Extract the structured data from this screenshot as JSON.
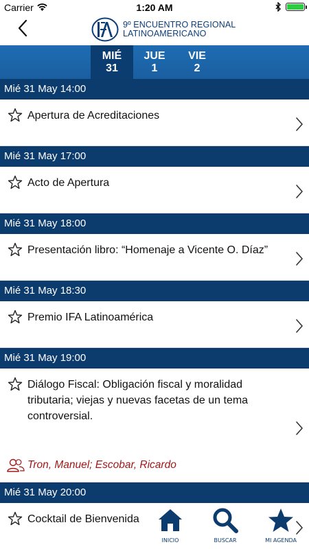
{
  "status_bar": {
    "carrier": "Carrier",
    "time": "1:20 AM"
  },
  "header": {
    "logo_line1": "9º ENCUENTRO REGIONAL",
    "logo_line2": "LATINOAMERICANO",
    "brand_color": "#0d3d78"
  },
  "tabs": [
    {
      "day": "MIÉ",
      "num": "31",
      "active": true
    },
    {
      "day": "JUE",
      "num": "1",
      "active": false
    },
    {
      "day": "VIE",
      "num": "2",
      "active": false
    }
  ],
  "sessions": [
    {
      "header": "Mié 31 May 14:00",
      "title": "Apertura de Acreditaciones"
    },
    {
      "header": "Mié 31 May 17:00",
      "title": "Acto de Apertura"
    },
    {
      "header": "Mié 31 May 18:00",
      "title": "Presentación libro: “Homenaje a Vicente O. Díaz”"
    },
    {
      "header": "Mié 31 May 18:30",
      "title": "Premio IFA Latinoamérica"
    },
    {
      "header": "Mié 31 May 19:00",
      "title": "Diálogo Fiscal: Obligación fiscal y moralidad tributaria; viejas y nuevas facetas de un tema controversial.",
      "speakers": "Tron, Manuel; Escobar, Ricardo"
    },
    {
      "header": "Mié 31 May 20:00",
      "title": "Cocktail de Bienvenida"
    }
  ],
  "bottom_nav": {
    "home_label": "INICIO",
    "search_label": "BUSCAR",
    "agenda_label": "MI AGENDA"
  },
  "colors": {
    "tab_bar": "#1f6cb3",
    "section_header": "#0c3b6e",
    "speaker_text": "#a01818"
  }
}
